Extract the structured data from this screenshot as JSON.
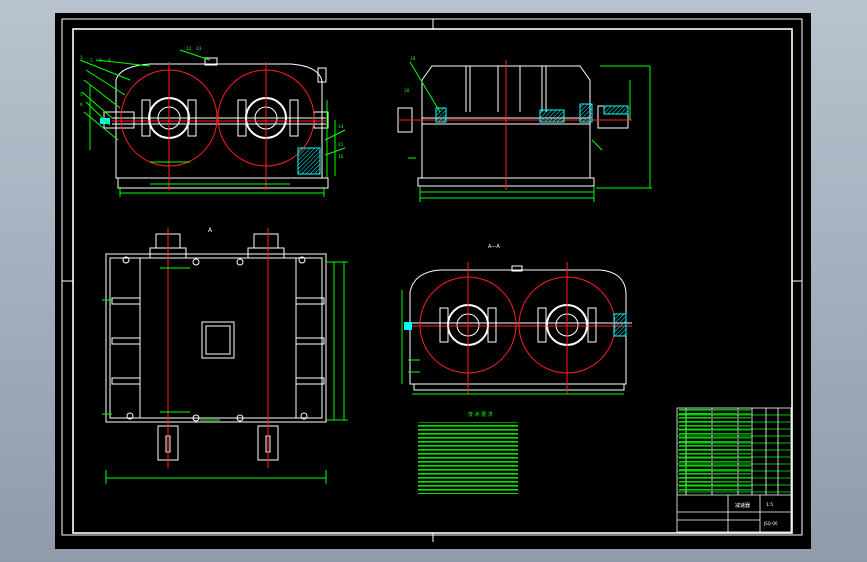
{
  "drawing": {
    "background": "#000000",
    "colors": {
      "outline": "#ffffff",
      "dimension": "#00ff00",
      "centerline": "#ff2020",
      "hatch": "#00ffff",
      "table": "#00ff00"
    },
    "view_labels": {
      "plan": "A",
      "section": "A—A"
    },
    "callout_numbers": [
      "1",
      "2",
      "3",
      "4",
      "5",
      "6",
      "7",
      "8",
      "9",
      "10",
      "11",
      "12",
      "13",
      "14",
      "15",
      "16",
      "17",
      "18",
      "19",
      "20",
      "21"
    ],
    "tech_requirements_title": "技 术 要 求",
    "title_block": {
      "drawing_name": "减速器",
      "scale": "1:5",
      "drawing_number": "JSQ-00"
    }
  }
}
